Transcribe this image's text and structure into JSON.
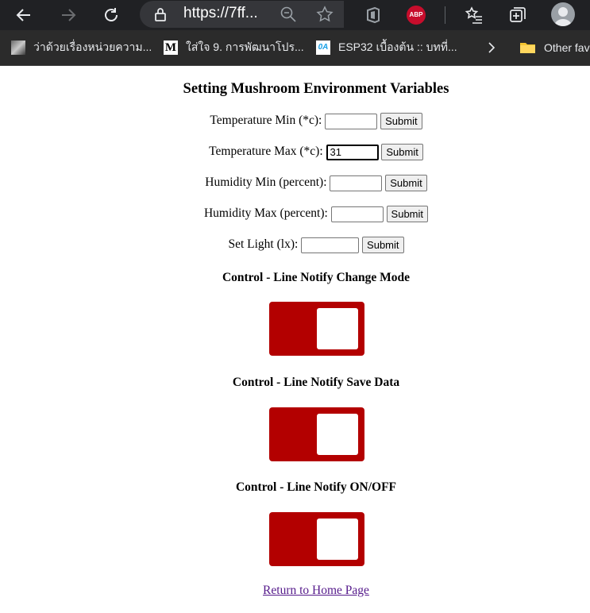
{
  "browser": {
    "url": "https://7ff...",
    "abp_label": "ABP",
    "bookmarks": [
      {
        "label": "ว่าด้วยเรื่องหน่วยความ..."
      },
      {
        "icon_text": "M",
        "label": "ใส่ใจ 9. การพัฒนาโปร..."
      },
      {
        "icon_text": "0A",
        "label": "ESP32 เบื้องต้น :: บทที่..."
      },
      {
        "label": "Other fav"
      }
    ]
  },
  "page": {
    "title": "Setting Mushroom Environment Variables",
    "fields": [
      {
        "label": "Temperature Min (*c):",
        "value": "",
        "button": "Submit"
      },
      {
        "label": "Temperature Max (*c):",
        "value": "31",
        "button": "Submit"
      },
      {
        "label": "Humidity Min (percent):",
        "value": "",
        "button": "Submit"
      },
      {
        "label": "Humidity Max (percent):",
        "value": "",
        "button": "Submit"
      },
      {
        "label": "Set Light (lx):",
        "value": "",
        "button": "Submit"
      }
    ],
    "controls": [
      {
        "title": "Control - Line Notify Change Mode",
        "state": "off"
      },
      {
        "title": "Control - Line Notify Save Data",
        "state": "off"
      },
      {
        "title": "Control - Line Notify ON/OFF",
        "state": "off"
      }
    ],
    "home_link": "Return to Home Page"
  },
  "colors": {
    "switch_off": "#b30000",
    "link": "#551a8b",
    "chrome_bg": "#202124"
  }
}
